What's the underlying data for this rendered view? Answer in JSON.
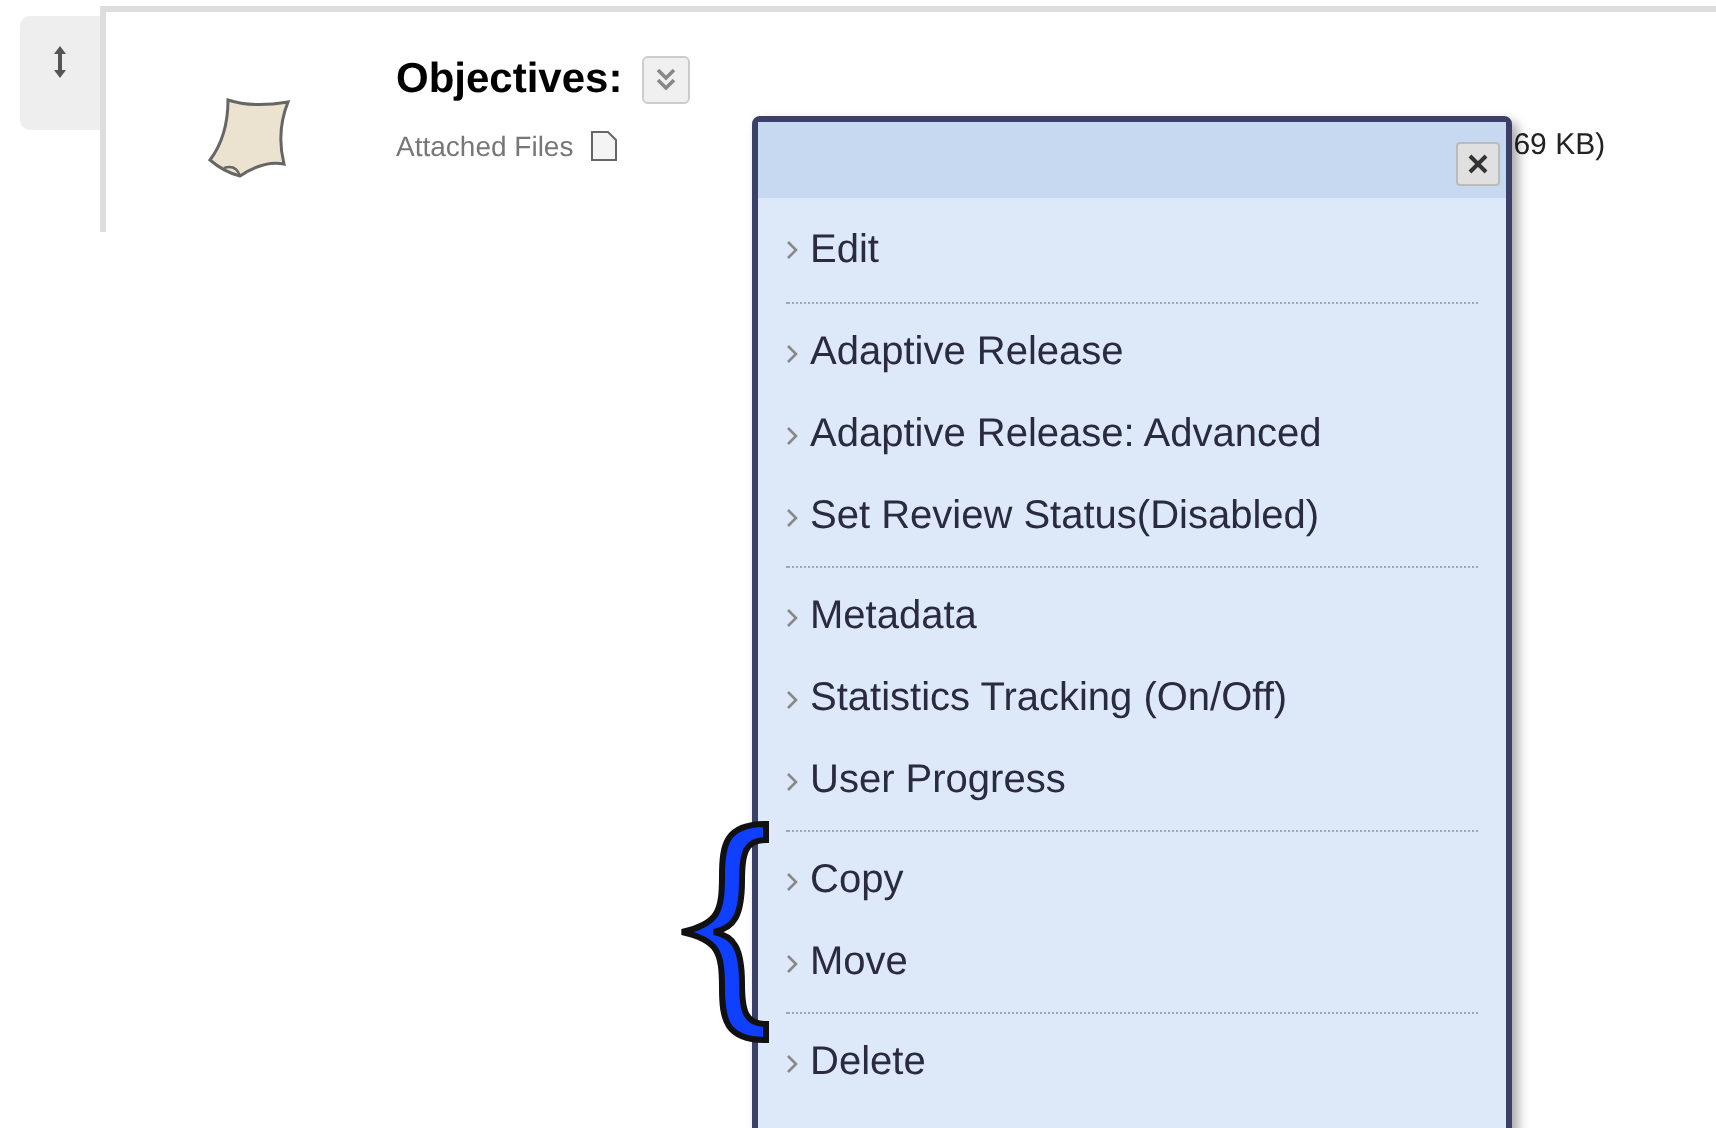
{
  "item": {
    "title": "Objectives:",
    "attachments_label": "Attached Files",
    "file_size_fragment": "69 KB)"
  },
  "menu": {
    "groups": [
      {
        "items": [
          "Edit"
        ]
      },
      {
        "items": [
          "Adaptive Release",
          "Adaptive Release: Advanced",
          "Set Review Status(Disabled)"
        ]
      },
      {
        "items": [
          "Metadata",
          "Statistics Tracking (On/Off)",
          "User Progress"
        ]
      },
      {
        "items": [
          "Copy",
          "Move"
        ]
      },
      {
        "items": [
          "Delete"
        ]
      }
    ]
  },
  "annotation": {
    "kind": "brace"
  }
}
